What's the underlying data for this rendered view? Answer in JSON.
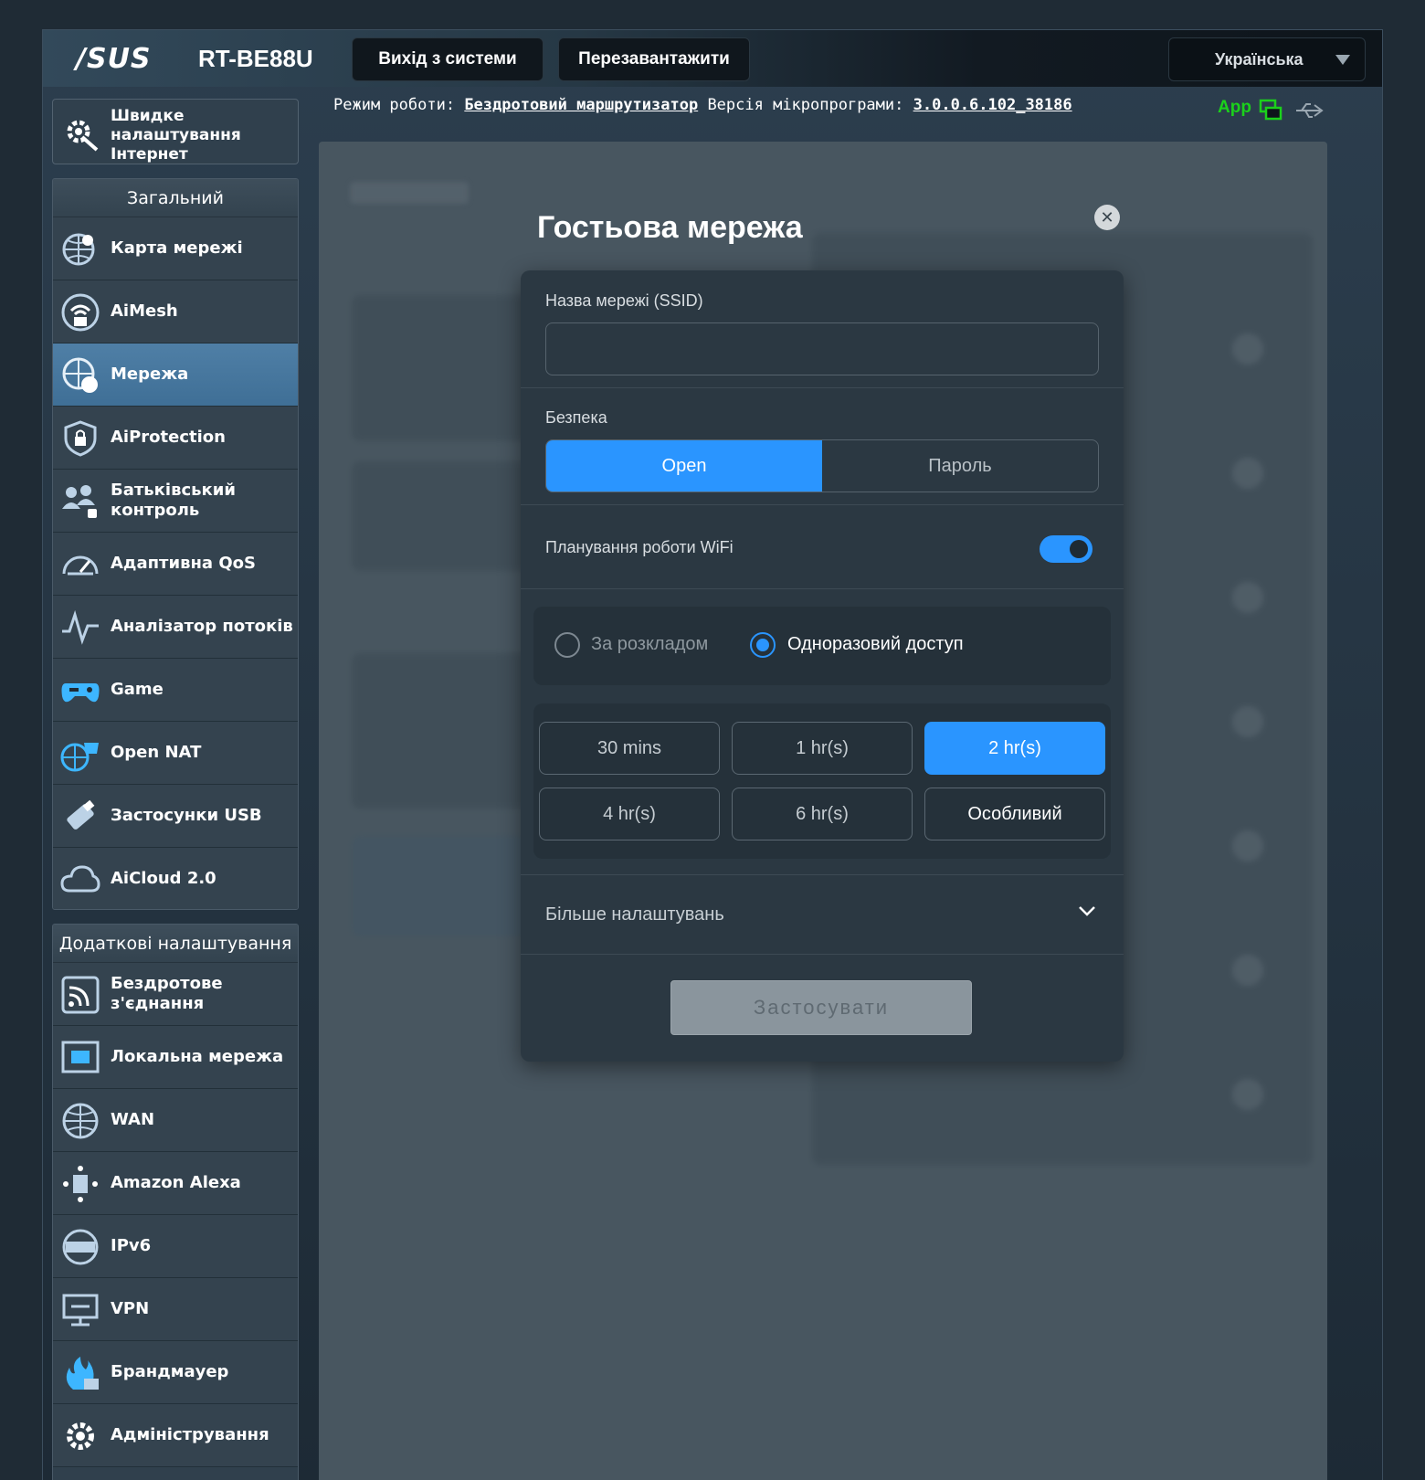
{
  "header": {
    "brand": "/SUS",
    "model": "RT-BE88U",
    "logout_label": "Вихід з системи",
    "reboot_label": "Перезавантажити",
    "language": "Українська"
  },
  "status": {
    "mode_label": "Режим роботи:",
    "mode_value": "Бездротовий маршрутизатор",
    "fw_label": "Версія мікропрограми:",
    "fw_value": "3.0.0.6.102_38186",
    "app_label": "App"
  },
  "sidebar": {
    "qis_label": "Швидке налаштування Інтернет",
    "general_header": "Загальний",
    "general_items": [
      {
        "label": "Карта мережі",
        "icon": "network-map-icon"
      },
      {
        "label": "AiMesh",
        "icon": "aimesh-icon"
      },
      {
        "label": "Мережа",
        "icon": "network-globe-icon",
        "active": true
      },
      {
        "label": "AiProtection",
        "icon": "shield-lock-icon"
      },
      {
        "label": "Батьківський контроль",
        "icon": "parental-control-icon"
      },
      {
        "label": "Адаптивна QoS",
        "icon": "gauge-icon"
      },
      {
        "label": "Аналізатор потоків",
        "icon": "traffic-analyzer-icon"
      },
      {
        "label": "Game",
        "icon": "gamepad-icon"
      },
      {
        "label": "Open NAT",
        "icon": "open-nat-icon"
      },
      {
        "label": "Застосунки USB",
        "icon": "usb-icon"
      },
      {
        "label": "AiCloud 2.0",
        "icon": "cloud-icon"
      }
    ],
    "advanced_header": "Додаткові налаштування",
    "advanced_items": [
      {
        "label": "Бездротове з'єднання",
        "icon": "wireless-icon"
      },
      {
        "label": "Локальна мережа",
        "icon": "lan-icon"
      },
      {
        "label": "WAN",
        "icon": "wan-globe-icon"
      },
      {
        "label": "Amazon Alexa",
        "icon": "alexa-icon"
      },
      {
        "label": "IPv6",
        "icon": "ipv6-icon"
      },
      {
        "label": "VPN",
        "icon": "vpn-icon"
      },
      {
        "label": "Брандмауер",
        "icon": "firewall-icon"
      },
      {
        "label": "Адміністрування",
        "icon": "admin-gear-icon"
      }
    ]
  },
  "modal": {
    "title": "Гостьова мережа",
    "ssid_label": "Назва мережі (SSID)",
    "ssid_value": "",
    "security_label": "Безпека",
    "security_options": [
      "Open",
      "Пароль"
    ],
    "security_selected": "Open",
    "schedule_label": "Планування роботи WiFi",
    "schedule_enabled": true,
    "access_options": [
      "За розкладом",
      "Одноразовий доступ"
    ],
    "access_selected": "Одноразовий доступ",
    "durations": [
      "30 mins",
      "1 hr(s)",
      "2 hr(s)",
      "4 hr(s)",
      "6 hr(s)",
      "Особливий"
    ],
    "duration_selected": "2 hr(s)",
    "more_label": "Більше налаштувань",
    "apply_label": "Застосувати"
  },
  "colors": {
    "accent": "#2a95ff",
    "app_green": "#1bd11b",
    "sidebar_active": "#4a7aa0"
  }
}
